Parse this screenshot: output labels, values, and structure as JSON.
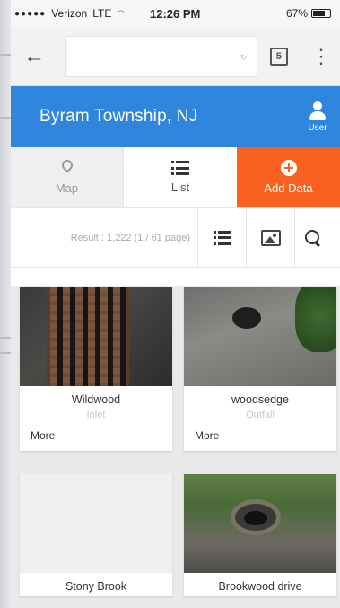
{
  "status_bar": {
    "carrier": "Verizon",
    "network": "LTE",
    "time": "12:26 PM",
    "battery": "67%"
  },
  "browser": {
    "tabs_count": "5"
  },
  "header": {
    "title": "Byram Township, NJ",
    "user_label": "User"
  },
  "nav": {
    "map_label": "Map",
    "list_label": "List",
    "add_label": "Add Data"
  },
  "results": {
    "summary": "Result : 1,222 (1 / 61 page)"
  },
  "cards": [
    {
      "title": "Wildwood",
      "type": "Inlet",
      "more": "More"
    },
    {
      "title": "woodsedge",
      "type": "Outfall",
      "more": "More"
    },
    {
      "title": "Stony Brook",
      "type": "",
      "more": ""
    },
    {
      "title": "Brookwood drive",
      "type": "",
      "more": ""
    }
  ],
  "colors": {
    "header_blue": "#2f86dc",
    "add_orange": "#f8611f"
  }
}
